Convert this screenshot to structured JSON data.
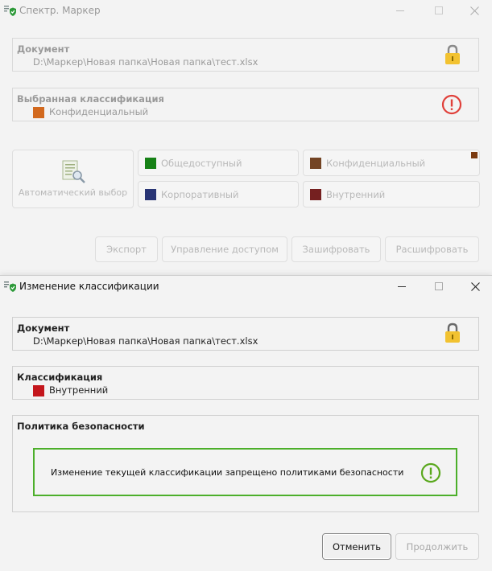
{
  "main_window": {
    "title": "Спектр. Маркер",
    "document": {
      "title": "Документ",
      "path": "D:\\Маркер\\Новая папка\\Новая папка\\тест.xlsx"
    },
    "selected": {
      "title": "Выбранная классификация",
      "value": "Конфиденциальный",
      "color": "#d2691e"
    },
    "auto_select_label": "Автоматический выбор",
    "classes": [
      {
        "label": "Общедоступный",
        "color": "#0a7a0a"
      },
      {
        "label": "Конфиденциальный",
        "color": "#6b3a18"
      },
      {
        "label": "Корпоративный",
        "color": "#1d2a6e"
      },
      {
        "label": "Внутренний",
        "color": "#6e1414"
      }
    ],
    "actions": [
      "Экспорт",
      "Управление доступом",
      "Зашифровать",
      "Расшифровать"
    ]
  },
  "dialog": {
    "title": "Изменение классификации",
    "document": {
      "title": "Документ",
      "path": "D:\\Маркер\\Новая папка\\Новая папка\\тест.xlsx"
    },
    "classification": {
      "title": "Классификация",
      "value": "Внутренний",
      "color": "#c4161c"
    },
    "policy": {
      "title": "Политика безопасности",
      "message": "Изменение текущей классификации запрещено политиками безопасности",
      "border_color": "#4caf2a"
    },
    "buttons": {
      "cancel": "Отменить",
      "continue": "Продолжить"
    }
  },
  "colors": {
    "lock": "#f2c230",
    "warning_red": "#e0403a",
    "warning_green": "#5aa81e",
    "shield": "#2e9a3a"
  }
}
